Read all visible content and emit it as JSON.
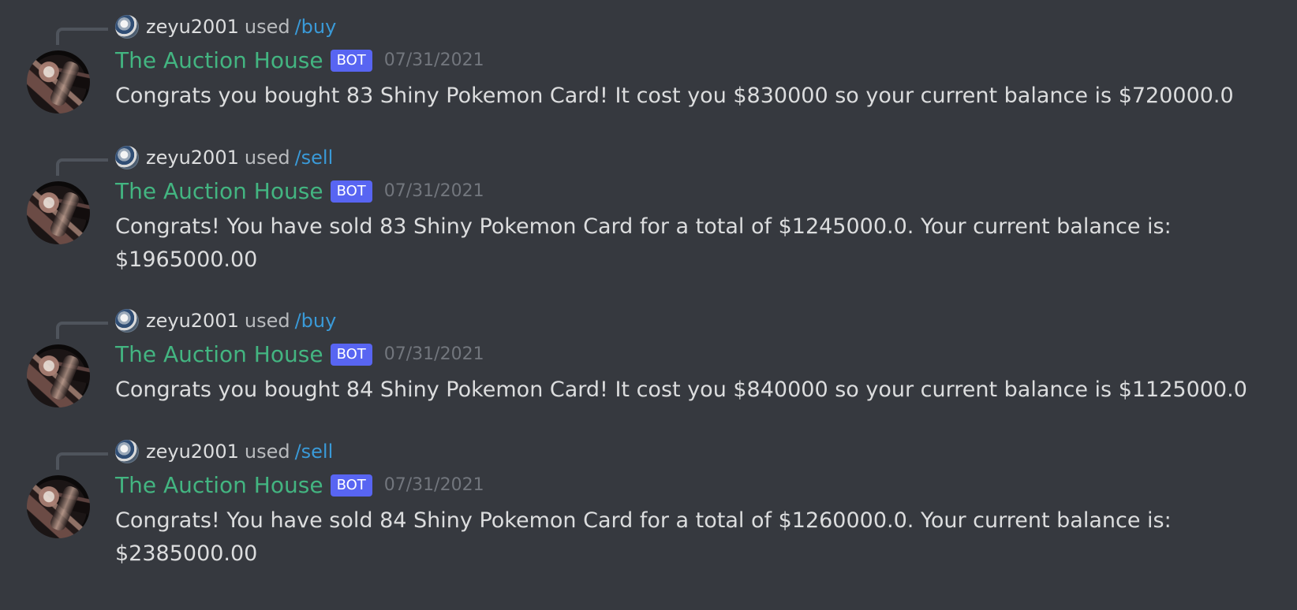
{
  "messages": [
    {
      "reply": {
        "user": "zeyu2001",
        "used": "used",
        "command": "/buy"
      },
      "author": "The Auction House",
      "badge": "BOT",
      "timestamp": "07/31/2021",
      "content": "Congrats you bought 83 Shiny Pokemon Card! It cost you $830000 so your current balance is $720000.0"
    },
    {
      "reply": {
        "user": "zeyu2001",
        "used": "used",
        "command": "/sell"
      },
      "author": "The Auction House",
      "badge": "BOT",
      "timestamp": "07/31/2021",
      "content": "Congrats! You have sold 83 Shiny Pokemon Card for a total of $1245000.0. Your current balance is: $1965000.00"
    },
    {
      "reply": {
        "user": "zeyu2001",
        "used": "used",
        "command": "/buy"
      },
      "author": "The Auction House",
      "badge": "BOT",
      "timestamp": "07/31/2021",
      "content": "Congrats you bought 84 Shiny Pokemon Card! It cost you $840000 so your current balance is $1125000.0"
    },
    {
      "reply": {
        "user": "zeyu2001",
        "used": "used",
        "command": "/sell"
      },
      "author": "The Auction House",
      "badge": "BOT",
      "timestamp": "07/31/2021",
      "content": "Congrats! You have sold 84 Shiny Pokemon Card for a total of $1260000.0. Your current balance is: $2385000.00"
    }
  ],
  "colors": {
    "background": "#36393f",
    "username": "#dcddde",
    "bot_name": "#43b581",
    "bot_badge": "#5865f2",
    "command": "#3a9ad8",
    "timestamp": "#72767d",
    "message_text": "#dcddde"
  },
  "icons": {
    "reply_avatar": "user-avatar-icon",
    "bot_avatar": "gavel-avatar-icon"
  }
}
